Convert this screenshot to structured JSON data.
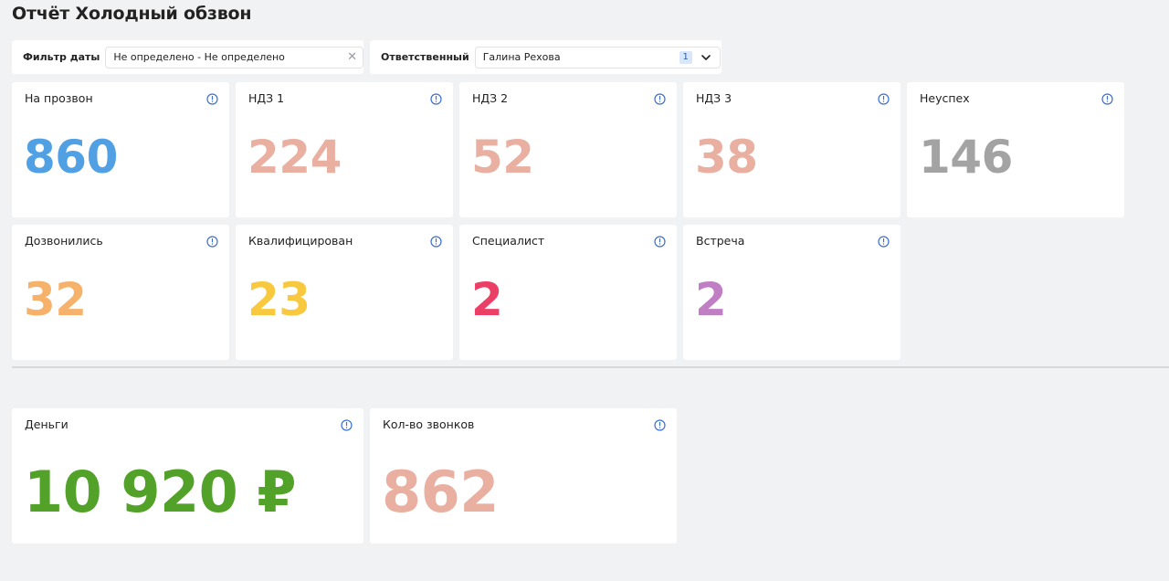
{
  "page": {
    "title": "Отчёт Холодный обзвон"
  },
  "filters": {
    "date": {
      "label": "Фильтр даты",
      "value": "Не определено - Не определено"
    },
    "responsible": {
      "label": "Ответственный",
      "value": "Галина Рехова",
      "count": "1"
    }
  },
  "icons": {
    "info": "info-icon",
    "clear": "close-icon",
    "dropdown": "chevron-down-icon"
  },
  "metrics": [
    {
      "label": "На прозвон",
      "value": "860",
      "color": "#52a0e4"
    },
    {
      "label": "НДЗ 1",
      "value": "224",
      "color": "#e9b0a2"
    },
    {
      "label": "НДЗ 2",
      "value": "52",
      "color": "#e9b0a2"
    },
    {
      "label": "НДЗ 3",
      "value": "38",
      "color": "#e9b0a2"
    },
    {
      "label": "Неуспех",
      "value": "146",
      "color": "#a3a3a3"
    },
    {
      "label": "Дозвонились",
      "value": "32",
      "color": "#f6b26b"
    },
    {
      "label": "Квалифицирован",
      "value": "23",
      "color": "#f8c93e"
    },
    {
      "label": "Специалист",
      "value": "2",
      "color": "#ec3f66"
    },
    {
      "label": "Встреча",
      "value": "2",
      "color": "#c07ec4"
    }
  ],
  "summary": [
    {
      "label": "Деньги",
      "value": "10 920 ₽",
      "color": "#52a128"
    },
    {
      "label": "Кол-во звонков",
      "value": "862",
      "color": "#e9b0a2"
    }
  ]
}
